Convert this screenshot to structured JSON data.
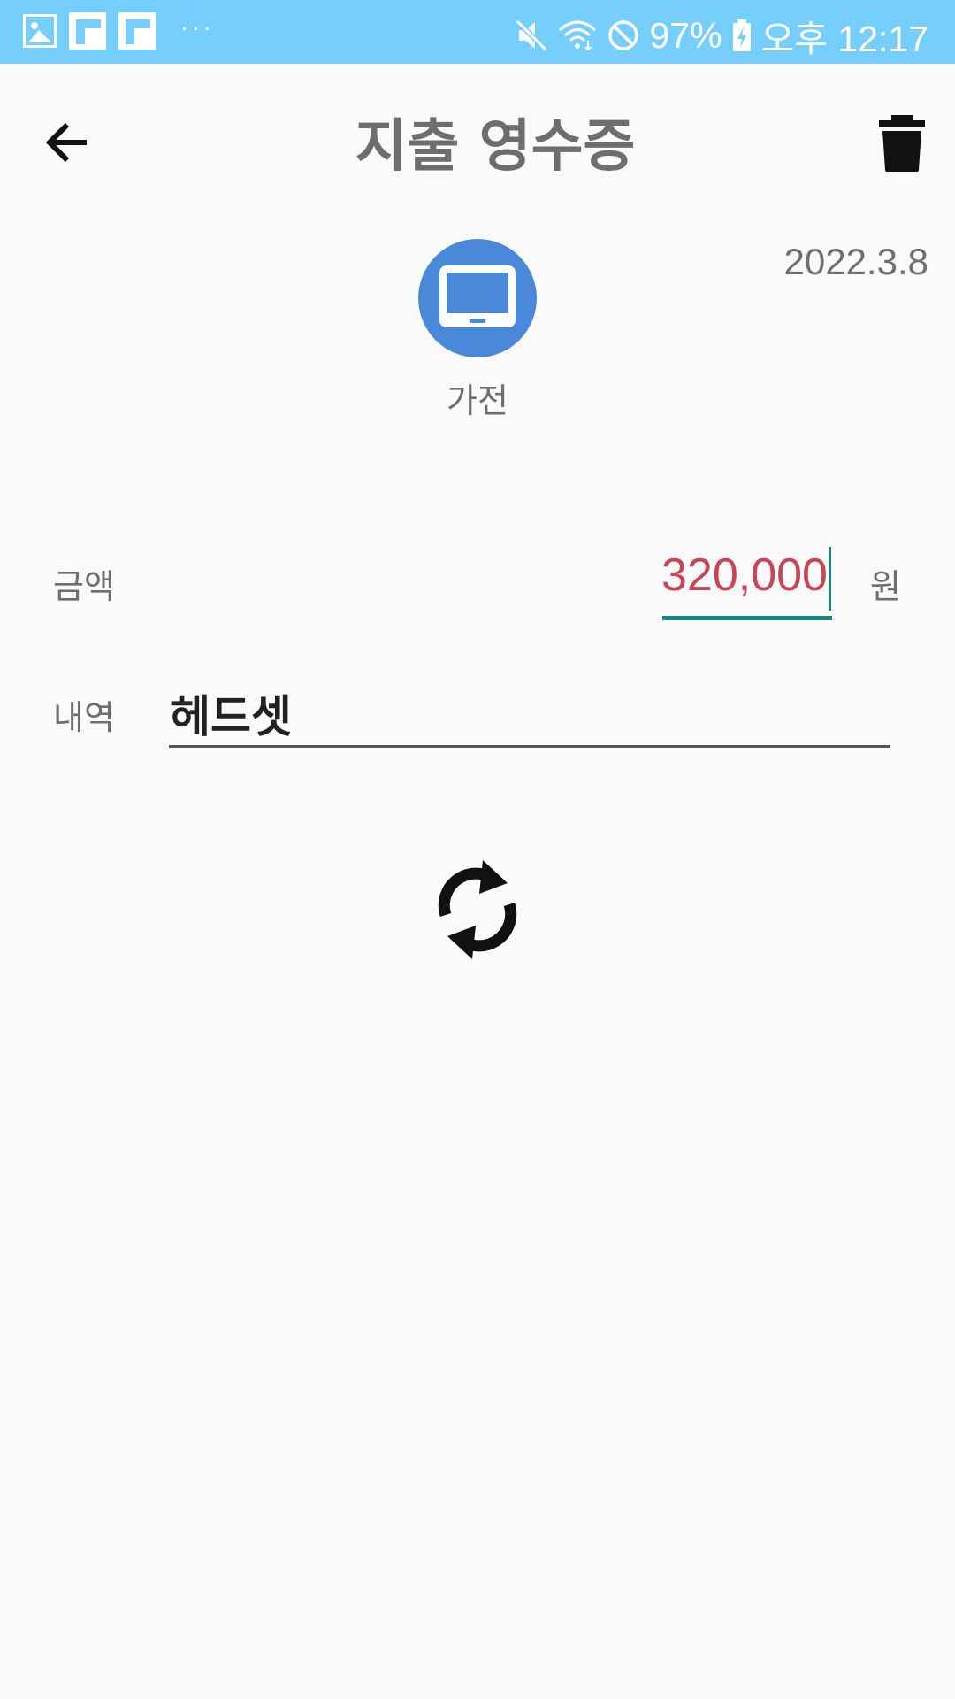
{
  "status_bar": {
    "battery": "97%",
    "time": "오후 12:17",
    "icons": [
      "gallery-icon",
      "flipboard-icon",
      "flipboard-icon",
      "more-dots-icon",
      "mute-icon",
      "wifi-icon",
      "do-not-disturb-icon",
      "battery-charging-icon"
    ],
    "more": "···"
  },
  "toolbar": {
    "title": "지출 영수증",
    "back_icon": "arrow-left-icon",
    "delete_icon": "trash-icon"
  },
  "receipt": {
    "date": "2022.3.8",
    "category": {
      "label": "가전",
      "icon": "monitor-icon",
      "color": "#4a88d9"
    },
    "amount": {
      "label": "금액",
      "value": "320,000",
      "unit": "원",
      "color": "#c94457"
    },
    "memo": {
      "label": "내역",
      "value": "헤드셋"
    },
    "refresh_icon": "sync-icon"
  },
  "colors": {
    "status_bar": "#75cefb",
    "accent": "#16877a",
    "background": "#fafafa"
  }
}
